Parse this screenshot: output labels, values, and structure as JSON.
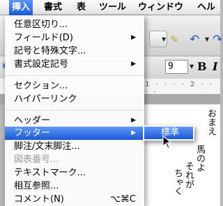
{
  "menubar": {
    "items": [
      "挿入",
      "書式",
      "表",
      "ツール",
      "ウィンドウ",
      "ヘル"
    ],
    "active_index": 0
  },
  "background": {
    "font_size_value": "9",
    "bold_label": "B",
    "italic_label": "I",
    "vertical_text": [
      "おまえ",
      "馬のよ",
      "それが",
      "ちゃく"
    ]
  },
  "menu": {
    "items": [
      {
        "label": "任意区切り..."
      },
      {
        "label": "フィールド(D)",
        "submenu": true
      },
      {
        "label": "記号と特殊文字..."
      },
      {
        "label": "書式設定記号",
        "submenu": true
      },
      {
        "label": "セクション..."
      },
      {
        "label": "ハイパーリンク"
      },
      {
        "label": "ヘッダー",
        "submenu": true
      },
      {
        "label": "フッター",
        "submenu": true,
        "highlighted": true
      },
      {
        "label": "脚注/文末脚注..."
      },
      {
        "label": "図表番号...",
        "disabled": true
      },
      {
        "label": "テキストマーク..."
      },
      {
        "label": "相互参照..."
      },
      {
        "label": "コメント(N)",
        "shortcut": "⌥⌘C"
      }
    ]
  },
  "submenu": {
    "items": [
      {
        "label": "標準",
        "highlighted": true
      }
    ]
  },
  "colors": {
    "highlight": "#1c5ad6",
    "disabled_text": "#9c9c9c"
  }
}
